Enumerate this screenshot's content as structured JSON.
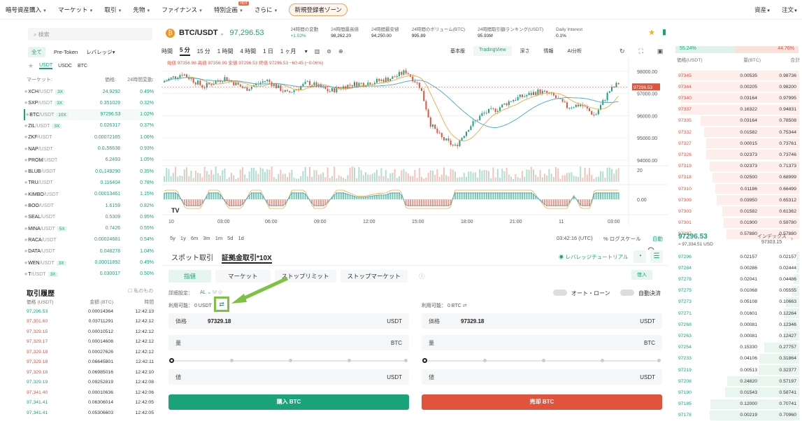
{
  "topnav": {
    "items": [
      "暗号資産購入",
      "マーケット",
      "取引",
      "先物",
      "ファイナンス",
      "特別企画",
      "さらに"
    ],
    "badge": "HOT",
    "promo": "新規登録者ゾーン",
    "right": [
      "資産",
      "注文"
    ]
  },
  "left": {
    "search_placeholder": "検索",
    "filters": [
      "全て",
      "Pre-Token",
      "レバレッジ"
    ],
    "quote_tabs": [
      "USDT",
      "USDC",
      "BTC"
    ],
    "header": {
      "market": "マーケット:",
      "price": "価格:",
      "change": "24時間変動:"
    },
    "markets": [
      {
        "base": "XCH",
        "quote": "/USDT",
        "tag": "3X",
        "price": "24.9292",
        "change": "0.49%"
      },
      {
        "base": "SXP",
        "quote": "/USDT",
        "tag": "3X",
        "price": "0.351029",
        "change": "0.32%"
      },
      {
        "base": "BTC",
        "quote": "/USDT",
        "tag": "10X",
        "price": "97296.53",
        "change": "1.02%"
      },
      {
        "base": "ZIL",
        "quote": "/USDT",
        "tag": "3X",
        "price": "0.026317",
        "change": "0.37%"
      },
      {
        "base": "ZKF",
        "quote": "/USDT",
        "tag": "",
        "price": "0.00072165",
        "change": "1.06%"
      },
      {
        "base": "NAP",
        "quote": "/USDT",
        "tag": "",
        "price": "0.0₄56638",
        "change": "0.93%"
      },
      {
        "base": "PROM",
        "quote": "/USDT",
        "tag": "",
        "price": "6.2493",
        "change": "1.05%"
      },
      {
        "base": "BLUB",
        "quote": "/USDT",
        "tag": "",
        "price": "0.0₆149290",
        "change": "0.35%"
      },
      {
        "base": "TRU",
        "quote": "/USDT",
        "tag": "",
        "price": "0.116404",
        "change": "0.78%"
      },
      {
        "base": "KIMBO",
        "quote": "/USDT",
        "tag": "",
        "price": "0.00013461",
        "change": "1.15%"
      },
      {
        "base": "BOO",
        "quote": "/USDT",
        "tag": "",
        "price": "1.6159",
        "change": "0.82%"
      },
      {
        "base": "SEAL",
        "quote": "/USDT",
        "tag": "",
        "price": "0.5309",
        "change": "0.95%"
      },
      {
        "base": "MINA",
        "quote": "/USDT",
        "tag": "5X",
        "price": "0.7426",
        "change": "0.55%"
      },
      {
        "base": "RACA",
        "quote": "/USDT",
        "tag": "",
        "price": "0.00024681",
        "change": "0.54%"
      },
      {
        "base": "DATA",
        "quote": "/USDT",
        "tag": "",
        "price": "0.048278",
        "change": "1.04%"
      },
      {
        "base": "WEN",
        "quote": "/USDT",
        "tag": "3X",
        "price": "0.00011892",
        "change": "0.49%"
      },
      {
        "base": "T",
        "quote": "/USDT",
        "tag": "3X",
        "price": "0.030017",
        "change": "0.50%"
      }
    ],
    "history_title": "取引履歴",
    "my_only": "私のもの",
    "history_header": {
      "price": "価格 (USDT)",
      "amount": "金額 (BTC)",
      "time": "時間"
    },
    "history": [
      {
        "p": "97,296.53",
        "a": "0.00014364",
        "t": "12:42:13",
        "side": "buy"
      },
      {
        "p": "97,301.60",
        "a": "0.03711291",
        "t": "12:42:12",
        "side": "sell"
      },
      {
        "p": "97,329.15",
        "a": "0.00010512",
        "t": "12:42:12",
        "side": "sell"
      },
      {
        "p": "97,329.17",
        "a": "0.00014608",
        "t": "12:42:12",
        "side": "sell"
      },
      {
        "p": "97,329.18",
        "a": "0.00027626",
        "t": "12:42:12",
        "side": "sell"
      },
      {
        "p": "97,329.18",
        "a": "0.06645801",
        "t": "12:42:11",
        "side": "sell"
      },
      {
        "p": "97,329.18",
        "a": "0.06985016",
        "t": "12:42:10",
        "side": "sell"
      },
      {
        "p": "97,329.19",
        "a": "0.09252819",
        "t": "12:42:08",
        "side": "buy"
      },
      {
        "p": "97,341.40",
        "a": "0.00010636",
        "t": "12:42:06",
        "side": "sell"
      },
      {
        "p": "97,341.41",
        "a": "0.06306014",
        "t": "12:42:05",
        "side": "buy"
      },
      {
        "p": "97,341.41",
        "a": "0.05306603",
        "t": "12:42:05",
        "side": "buy"
      }
    ]
  },
  "ticker": {
    "pair": "BTC/USDT",
    "price": "97,296.53",
    "stats": [
      {
        "l": "24時間の変動",
        "v": "+1.02%"
      },
      {
        "l": "24時間最高値",
        "v": "98,262.20"
      },
      {
        "l": "24時間最安値",
        "v": "94,250.00"
      },
      {
        "l": "24時間のボリューム(BTC)",
        "v": "995.89"
      },
      {
        "l": "24時間取引額ランキング(USDT)",
        "v": "95.93M"
      },
      {
        "l": "Daily Interest",
        "v": "0.1%"
      }
    ]
  },
  "chart": {
    "intervals": [
      "時間",
      "5 分",
      "15 分",
      "1 時間",
      "4 時間",
      "1 日",
      "1 ヶ月"
    ],
    "views": [
      "基本版",
      "TradingView",
      "深さ",
      "情報",
      "AI分析"
    ],
    "ohlc": "始値 97356.98 高値 97356.99 安値 97296.53 終値 97296.53 −60.45 (−0.06%)",
    "price_label": "97296.53",
    "y_ticks": [
      "98000.00",
      "97000.00",
      "96000.00",
      "95000.00",
      "94000.00"
    ],
    "vol_tick": "20",
    "macd_tick": "0.00",
    "x_ticks": [
      "10",
      "03:00",
      "06:00",
      "09:00",
      "12:00",
      "15:00",
      "18:00",
      "21:00",
      "11",
      "03:00"
    ],
    "ranges": [
      "5y",
      "1y",
      "6m",
      "3m",
      "1m",
      "5d",
      "1d"
    ],
    "clock": "03:42:16 (UTC)",
    "log": "%  ログスケール",
    "auto": "自動"
  },
  "order": {
    "tabs": [
      "スポット取引",
      "証拠金取引*10X"
    ],
    "tutorial": "レバレッジチュートリアル",
    "types": [
      "指値",
      "マーケット",
      "ストップリミット",
      "ストップマーケット"
    ],
    "borrow": "借入",
    "detail": "詳細設定：",
    "detail_val": "AL",
    "auto_loan": "オート・ローン",
    "auto_repay": "自動決済",
    "buy": {
      "avail": "利用可能： 0 USDT",
      "price_label": "価格",
      "price": "97329.18",
      "price_unit": "USDT",
      "qty_label": "量",
      "qty_unit": "BTC",
      "total_label": "値",
      "total_unit": "USDT",
      "btn": "購入 BTC"
    },
    "sell": {
      "avail": "利用可能： 0 BTC",
      "price_label": "価格",
      "price": "97329.18",
      "price_unit": "USDT",
      "qty_label": "量",
      "qty_unit": "BTC",
      "total_label": "値",
      "total_unit": "USDT",
      "btn": "売却 BTC"
    }
  },
  "orderbook": {
    "buy_pct": "55.24%",
    "sell_pct": "44.76%",
    "header": {
      "price": "価格(USDT)",
      "qty": "量(BTC)",
      "total": "合計"
    },
    "asks": [
      {
        "p": "97345",
        "q": "0.00535",
        "t": "0.98736"
      },
      {
        "p": "97344",
        "q": "0.00205",
        "t": "0.98200"
      },
      {
        "p": "97340",
        "q": "0.03164",
        "t": "0.97995"
      },
      {
        "p": "97337",
        "q": "0.16322",
        "t": "0.94831"
      },
      {
        "p": "97335",
        "q": "0.03164",
        "t": "0.78508"
      },
      {
        "p": "97332",
        "q": "0.01582",
        "t": "0.75344"
      },
      {
        "p": "97327",
        "q": "0.00015",
        "t": "0.73761"
      },
      {
        "p": "97326",
        "q": "0.02373",
        "t": "0.73746"
      },
      {
        "p": "97319",
        "q": "0.02373",
        "t": "0.71373"
      },
      {
        "p": "97318",
        "q": "0.02500",
        "t": "0.68999"
      },
      {
        "p": "97310",
        "q": "0.01186",
        "t": "0.66499"
      },
      {
        "p": "97309",
        "q": "0.03950",
        "t": "0.65312"
      },
      {
        "p": "97303",
        "q": "0.01582",
        "t": "0.61362"
      },
      {
        "p": "97301",
        "q": "0.01900",
        "t": "0.59780"
      },
      {
        "p": "97297",
        "q": "0.57880",
        "t": "0.57880"
      }
    ],
    "last": "97296.53",
    "last_sub": "≈ 97,334.51 USD",
    "index_label": "インデックス",
    "index": "97303.15",
    "bids": [
      {
        "p": "97296",
        "q": "0.02157",
        "t": "0.02157"
      },
      {
        "p": "97284",
        "q": "0.00286",
        "t": "0.02444"
      },
      {
        "p": "97278",
        "q": "0.02041",
        "t": "0.04486"
      },
      {
        "p": "97275",
        "q": "0.01068",
        "t": "0.05555"
      },
      {
        "p": "97273",
        "q": "0.05108",
        "t": "0.10663"
      },
      {
        "p": "97271",
        "q": "0.01601",
        "t": "0.12264"
      },
      {
        "p": "97268",
        "q": "0.00081",
        "t": "0.12346"
      },
      {
        "p": "97263",
        "q": "0.00081",
        "t": "0.12427"
      },
      {
        "p": "97254",
        "q": "0.15330",
        "t": "0.27757"
      },
      {
        "p": "97233",
        "q": "0.04106",
        "t": "0.31864"
      },
      {
        "p": "97219",
        "q": "0.00513",
        "t": "0.32377"
      },
      {
        "p": "97208",
        "q": "0.24820",
        "t": "0.57197"
      },
      {
        "p": "97190",
        "q": "0.01543",
        "t": "0.58741"
      },
      {
        "p": "97185",
        "q": "0.12000",
        "t": "0.70741"
      },
      {
        "p": "97178",
        "q": "0.00219",
        "t": "0.70960"
      }
    ]
  },
  "colors": {
    "green": "#1aa37a",
    "red": "#e0533d",
    "highlight": "#7dc242"
  }
}
